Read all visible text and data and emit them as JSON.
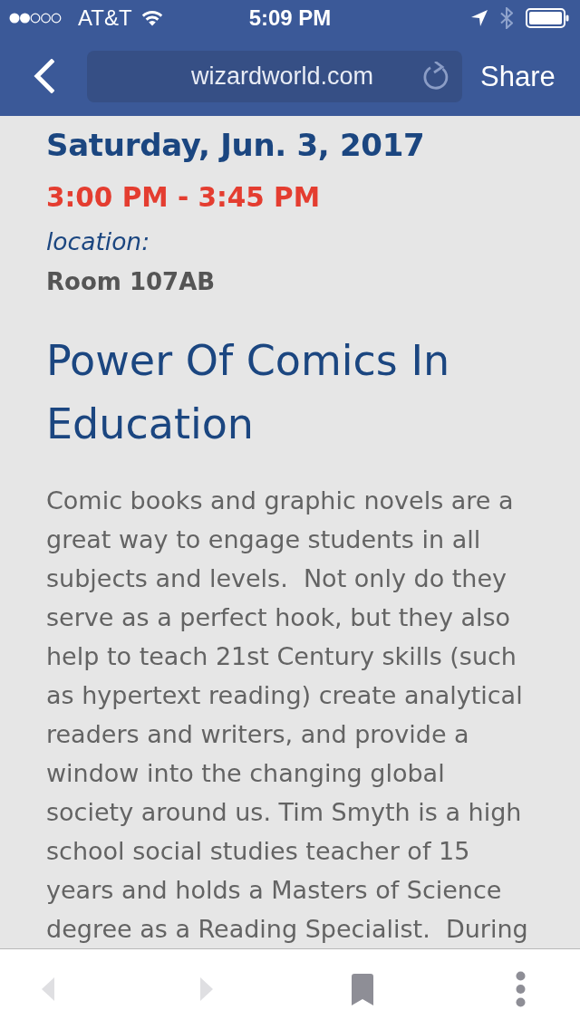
{
  "status_bar": {
    "carrier": "AT&T",
    "time": "5:09 PM"
  },
  "nav_bar": {
    "url": "wizardworld.com",
    "share": "Share"
  },
  "session": {
    "date": "Saturday, Jun. 3, 2017",
    "time": "3:00 PM - 3:45 PM",
    "location_label": "location:",
    "location": "Room 107AB",
    "title": "Power Of Comics In Education",
    "description": "Comic books and graphic novels are a great way to engage students in all subjects and levels.  Not only do they serve as a perfect hook, but they also help to teach 21st Century skills (such as hypertext reading) create analytical readers and writers, and provide a window into the changing global society around us. Tim Smyth is a high school social studies teacher of 15 years and holds a Masters of Science degree as a Reading Specialist.  During"
  },
  "toolbar": {
    "buttons": [
      {
        "kind": "back",
        "disabled": true
      },
      {
        "kind": "forward",
        "disabled": true
      },
      {
        "kind": "bookmarks",
        "disabled": false
      },
      {
        "kind": "more",
        "disabled": false
      }
    ]
  }
}
